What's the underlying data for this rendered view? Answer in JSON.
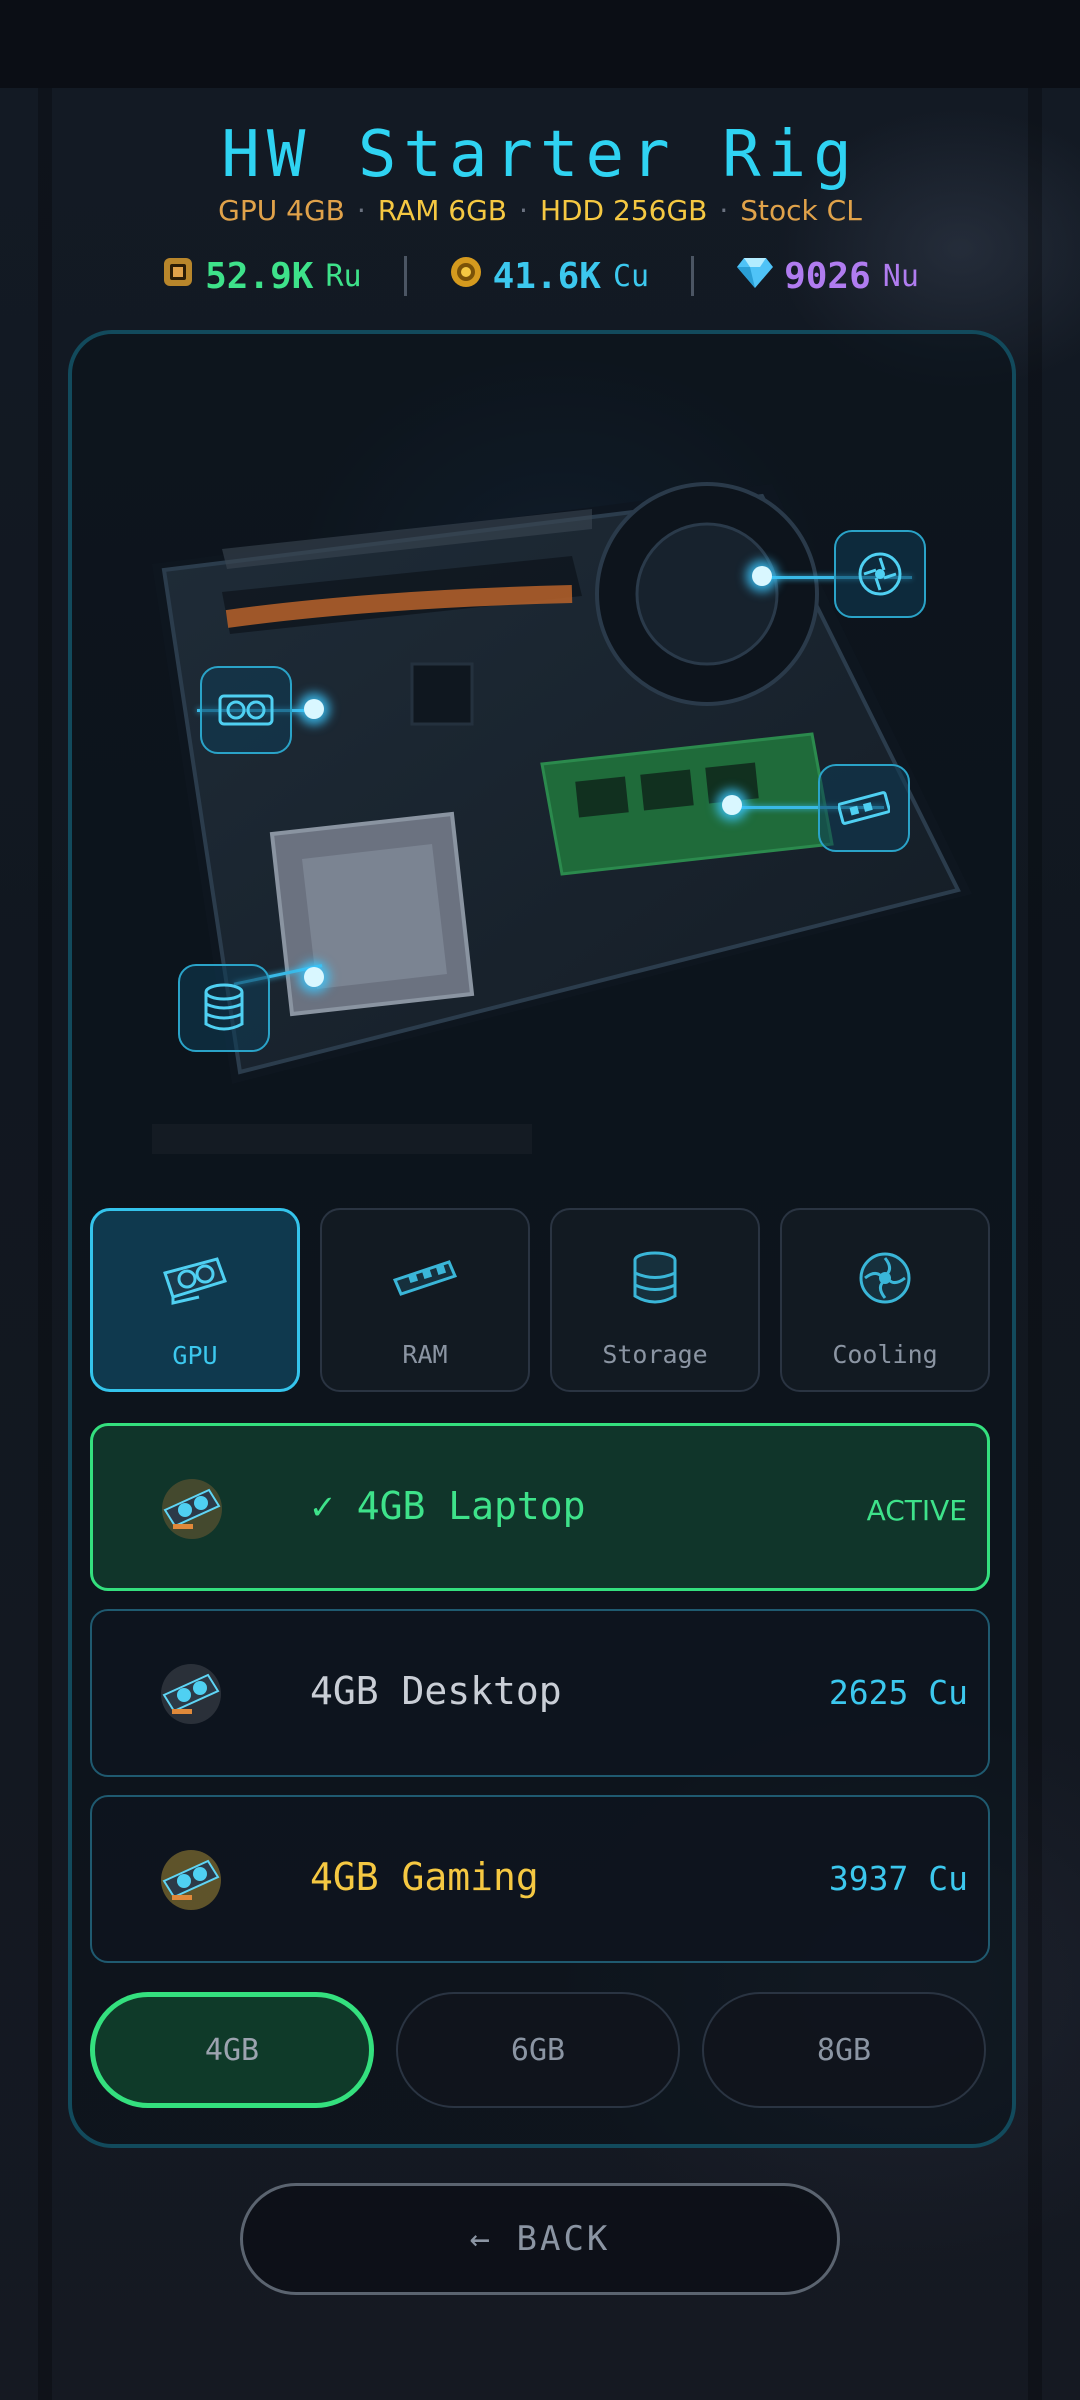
{
  "header": {
    "title": "HW Starter Rig",
    "specs": [
      "GPU 4GB",
      "RAM 6GB",
      "HDD 256GB",
      "Stock CL"
    ],
    "separator": "·"
  },
  "currencies": [
    {
      "value": "52.9K",
      "unit": "Ru",
      "icon": "chip-coin-icon",
      "color": "#3ee28a"
    },
    {
      "value": "41.6K",
      "unit": "Cu",
      "icon": "gold-coin-icon",
      "color": "#3cc8ee"
    },
    {
      "value": "9026",
      "unit": "Nu",
      "icon": "diamond-icon",
      "color": "#b07cf0"
    }
  ],
  "hotspots": [
    "gpu-hotspot",
    "ram-hotspot",
    "storage-hotspot",
    "cooling-hotspot"
  ],
  "tabs": [
    {
      "label": "GPU",
      "icon": "gpu-icon",
      "active": true
    },
    {
      "label": "RAM",
      "icon": "ram-icon",
      "active": false
    },
    {
      "label": "Storage",
      "icon": "storage-icon",
      "active": false
    },
    {
      "label": "Cooling",
      "icon": "cooling-icon",
      "active": false
    }
  ],
  "items": [
    {
      "name": "4GB Laptop",
      "check": "✓",
      "status": "ACTIVE",
      "active": true
    },
    {
      "name": "4GB Desktop",
      "price": "2625 Cu",
      "active": false
    },
    {
      "name": "4GB Gaming",
      "price": "3937 Cu",
      "active": false
    }
  ],
  "sizes": [
    {
      "label": "4GB",
      "active": true
    },
    {
      "label": "6GB",
      "active": false
    },
    {
      "label": "8GB",
      "active": false
    }
  ],
  "back_label": "← BACK",
  "colors": {
    "accent": "#34c4ec",
    "active_green": "#34e07e",
    "gold": "#f5c842"
  }
}
